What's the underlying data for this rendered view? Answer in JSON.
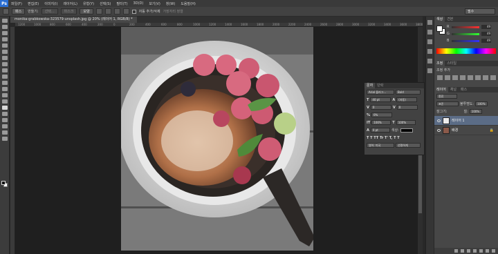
{
  "app": {
    "logo": "Ps"
  },
  "menu": [
    "파일(F)",
    "편집(E)",
    "이미지(I)",
    "레이어(L)",
    "유형(Y)",
    "선택(S)",
    "필터(T)",
    "3D(D)",
    "보기(V)",
    "창(W)",
    "도움말(H)"
  ],
  "options": {
    "mode": "패스",
    "make_label": "만들기:",
    "selection_btn": "선택...",
    "mask_btn": "마스크",
    "shape_btn": "모양",
    "auto_add_label": "자동 추가/삭제",
    "align_edges": "가장자리 정렬",
    "workspace": "필수"
  },
  "document": {
    "tab_title": "monika-grabkowska-323579-unsplash.jpg @ 20% (레이어 1, RGB/8) *"
  },
  "ruler_ticks": [
    "1200",
    "1000",
    "800",
    "600",
    "400",
    "200",
    "0",
    "200",
    "400",
    "600",
    "800",
    "1000",
    "1200",
    "1400",
    "1600",
    "1800",
    "2000",
    "2200",
    "2400",
    "2600",
    "2800",
    "3000",
    "3200",
    "3400",
    "3600",
    "3800"
  ],
  "color_panel": {
    "tabs": [
      "색상",
      "견본"
    ],
    "sliders": [
      {
        "label": "R",
        "value": "49",
        "color": "#ff3030"
      },
      {
        "label": "G",
        "value": "49",
        "color": "#30ff30"
      },
      {
        "label": "B",
        "value": "49",
        "color": "#3060ff"
      }
    ]
  },
  "adjustments": {
    "tabs": [
      "조정",
      "스타일"
    ],
    "title": "조정 추가"
  },
  "layers_panel": {
    "tabs": [
      "레이어",
      "채널",
      "패스"
    ],
    "kind": "종류",
    "blend": "표준",
    "opacity_label": "불투명도:",
    "opacity": "100%",
    "lock_label": "잠그기:",
    "fill_label": "칠:",
    "fill": "100%",
    "layers": [
      {
        "name": "레이어 1",
        "selected": true
      },
      {
        "name": "배경",
        "selected": false
      }
    ]
  },
  "character_panel": {
    "tabs": [
      "문자",
      "단락"
    ],
    "font": "Arial 플러그...",
    "style": "Bold",
    "size": "40 pt",
    "leading": "(자동)",
    "tracking": "0",
    "kerning": "0",
    "scale_label": "0%",
    "vscale": "100%",
    "hscale": "100%",
    "baseline": "0 pt",
    "color_label": "색상:",
    "language": "영어: 미국",
    "aa": "선명하게"
  },
  "colors": {
    "accent": "#5b6c86",
    "ps_blue": "#2a6ed3"
  }
}
